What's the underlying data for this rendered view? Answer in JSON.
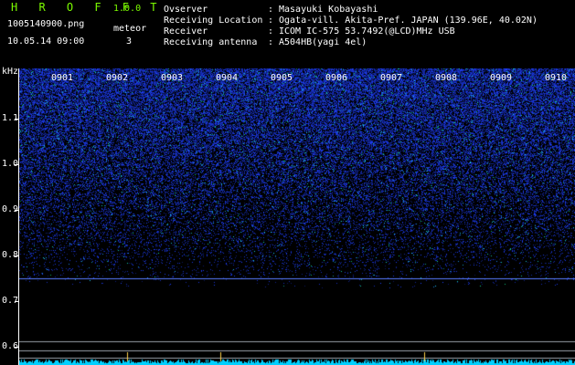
{
  "header": {
    "app_name": "H R O F F T",
    "version": "1.0.0",
    "filename": "1005140900.png",
    "datetime": "10.05.14 09:00",
    "meteor_label": "meteor",
    "meteor_count": "3",
    "info": [
      {
        "label": "Ovserver",
        "value": "Masayuki Kobayashi"
      },
      {
        "label": "Receiving Location",
        "value": "Ogata-vill. Akita-Pref. JAPAN (139.96E, 40.02N)"
      },
      {
        "label": "Receiver",
        "value": "ICOM IC-575 53.7492(@LCD)MHz USB"
      },
      {
        "label": "Receiving antenna",
        "value": "A504HB(yagi 4el)"
      }
    ]
  },
  "spectrogram": {
    "y_unit": "kHz",
    "y_ticks": [
      "1.1",
      "1.0",
      "0.9",
      "0.8",
      "0.7",
      "0.6"
    ],
    "x_ticks": [
      "0901",
      "0902",
      "0903",
      "0904",
      "0905",
      "0906",
      "0907",
      "0908",
      "0909",
      "0910"
    ],
    "y_range_khz": [
      0.57,
      1.17
    ],
    "carrier_line_khz": 0.745,
    "ref_lines_khz": [
      0.618,
      0.6,
      0.585
    ],
    "colors": {
      "background": "#000000",
      "signal": "#1e3cff",
      "carrier": "#5a7cff",
      "baseline": "#00d0ff",
      "text": "#ffffff",
      "title": "#7cfc00"
    }
  }
}
